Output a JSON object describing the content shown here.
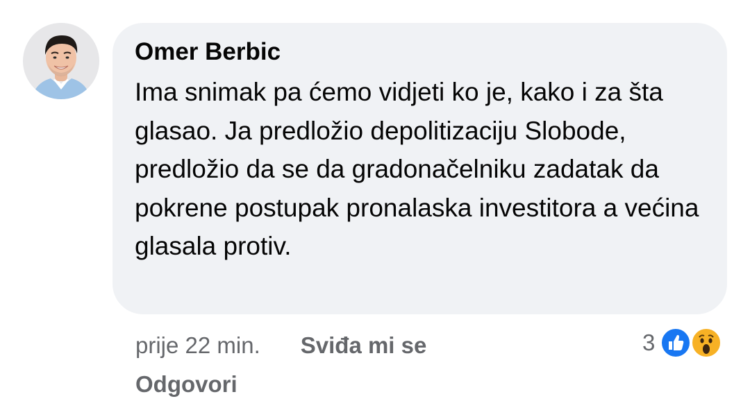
{
  "comment": {
    "author": "Omer Berbic",
    "text": "Ima snimak pa ćemo vidjeti ko je, kako i za šta glasao. Ja predložio depolitizaciju Slobode, predložio da se da gradonačelniku zadatak da pokrene postupak pronalaska investitora a većina glasala protiv.",
    "timestamp": "prije 22 min.",
    "like_label": "Sviđa mi se",
    "reply_label": "Odgovori",
    "reactions": {
      "count": "3",
      "icons": [
        "like-icon",
        "wow-icon"
      ]
    }
  },
  "colors": {
    "bubble_bg": "#f0f2f5",
    "text": "#050505",
    "secondary": "#65676b",
    "like_blue": "#1877f2",
    "wow_yellow": "#f7b125"
  }
}
